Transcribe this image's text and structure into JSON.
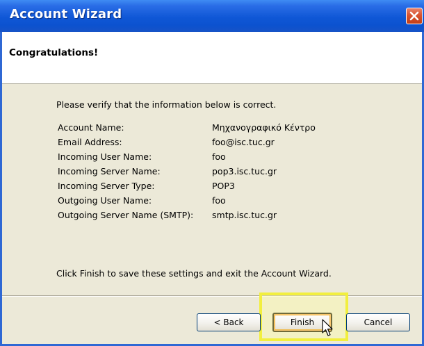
{
  "window": {
    "title": "Account Wizard",
    "close_icon": "close-icon"
  },
  "header": {
    "title": "Congratulations!"
  },
  "body": {
    "intro": "Please verify that the information below is correct.",
    "fields": [
      {
        "label": "Account Name:",
        "value": "Μηχανογραφικό Κέντρο"
      },
      {
        "label": "Email Address:",
        "value": "foo@isc.tuc.gr"
      },
      {
        "label": "Incoming User Name:",
        "value": "foo"
      },
      {
        "label": "Incoming Server Name:",
        "value": "pop3.isc.tuc.gr"
      },
      {
        "label": "Incoming Server Type:",
        "value": "POP3"
      },
      {
        "label": "Outgoing User Name:",
        "value": "foo"
      },
      {
        "label": "Outgoing Server Name (SMTP):",
        "value": "smtp.isc.tuc.gr"
      }
    ],
    "outro": "Click Finish to save these settings and exit the Account Wizard."
  },
  "buttons": {
    "back_label": "< Back",
    "finish_label": "Finish",
    "cancel_label": "Cancel"
  },
  "colors": {
    "titlebar": "#0f57d6",
    "close_button": "#d9532f",
    "dialog_background": "#ece9d8",
    "highlight": "#f2ef3e"
  },
  "icons": [
    "close-icon",
    "mouse-pointer-icon"
  ]
}
